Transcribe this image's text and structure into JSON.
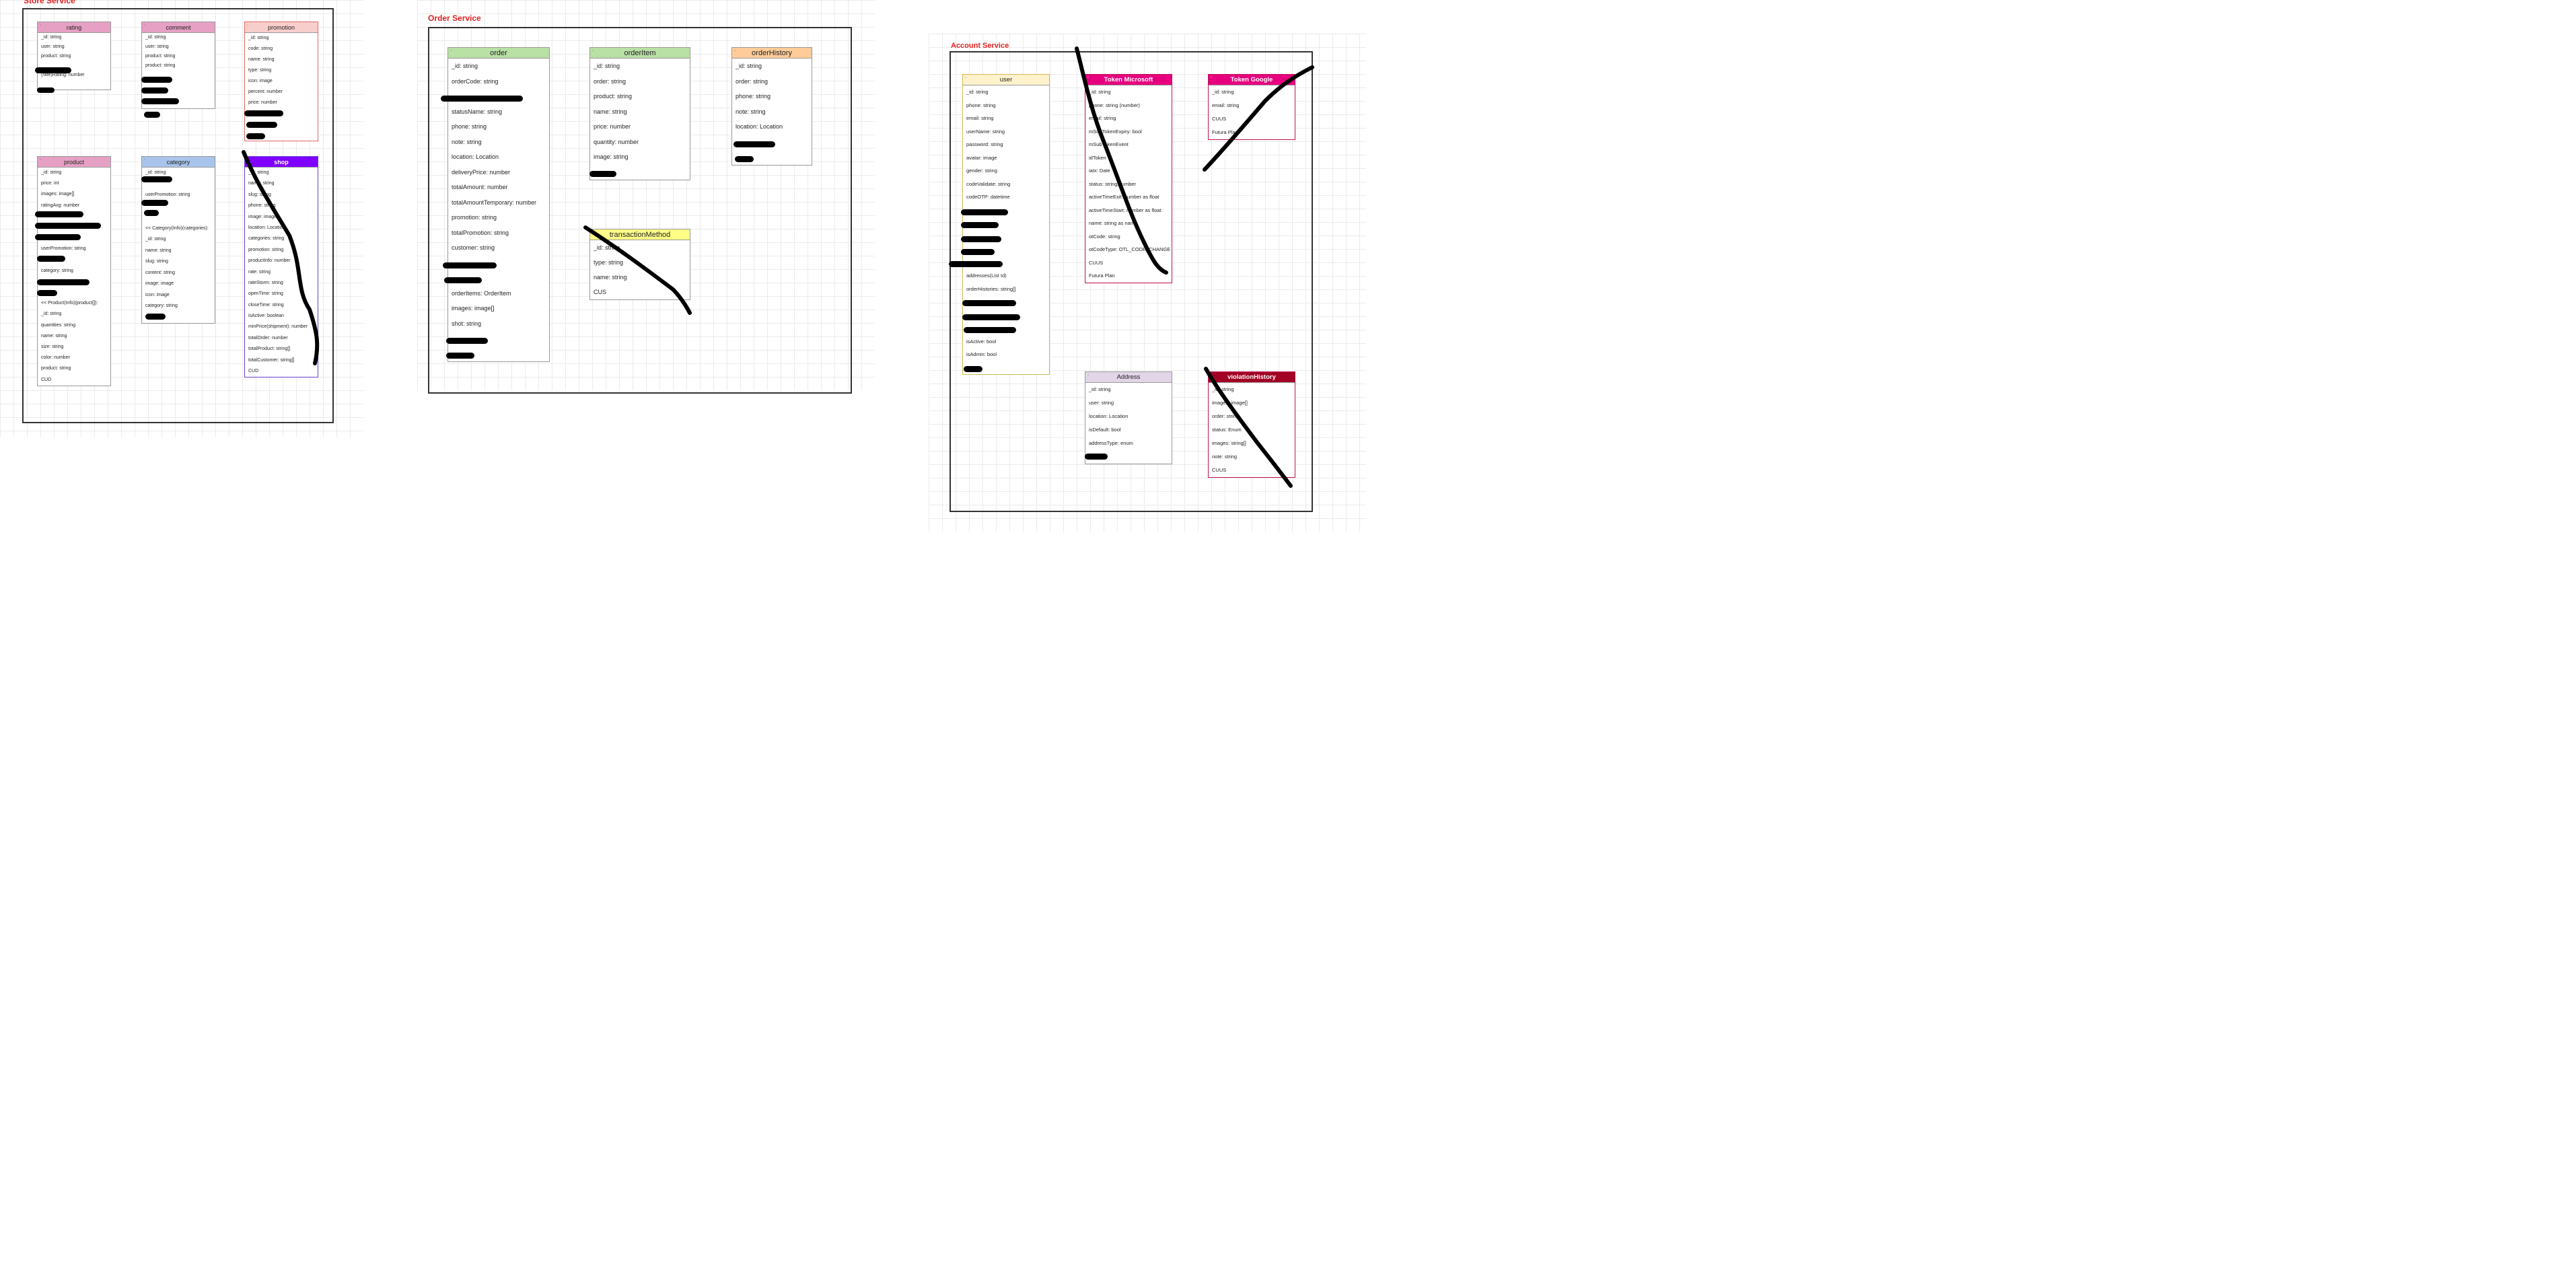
{
  "services": {
    "store": {
      "title": "Store Service"
    },
    "order": {
      "title": "Order Service"
    },
    "account": {
      "title": "Account Service"
    }
  },
  "entities": {
    "rating": {
      "title": "rating",
      "rows": [
        {
          "text": "_id: string"
        },
        {
          "text": "user: string",
          "c": "blue"
        },
        {
          "text": "product: string",
          "c": "blue"
        },
        {
          "text": ""
        },
        {
          "text": "(rate)Rating: number"
        },
        {
          "text": ""
        }
      ]
    },
    "comment": {
      "title": "comment",
      "rows": [
        {
          "text": "_id: string"
        },
        {
          "text": "user: string",
          "c": "blue"
        },
        {
          "text": "product: string",
          "c": "blue"
        },
        {
          "text": "product: string",
          "c": "blue"
        },
        {
          "text": ""
        },
        {
          "text": ""
        },
        {
          "text": ""
        },
        {
          "text": ""
        }
      ]
    },
    "promotion": {
      "title": "promotion",
      "rows": [
        {
          "text": "_id: string"
        },
        {
          "text": "code: string"
        },
        {
          "text": "name: string"
        },
        {
          "text": "type: string"
        },
        {
          "text": "icon: image"
        },
        {
          "text": "percent: number"
        },
        {
          "text": "price: number"
        },
        {
          "text": ""
        },
        {
          "text": ""
        },
        {
          "text": ""
        }
      ]
    },
    "product": {
      "title": "product",
      "rows": [
        {
          "text": "_id: string"
        },
        {
          "text": "price: int"
        },
        {
          "text": "images: image[]"
        },
        {
          "text": "ratingAvg: number"
        },
        {
          "text": ""
        },
        {
          "text": ""
        },
        {
          "text": ""
        },
        {
          "text": "userPromotion: string",
          "c": "blue"
        },
        {
          "text": ""
        },
        {
          "text": "category: string",
          "c": "blue"
        },
        {
          "text": ""
        },
        {
          "text": ""
        },
        {
          "text": "<< Product(Info)(product[]):",
          "c": "blue"
        },
        {
          "text": "   _id: string"
        },
        {
          "text": "   quantities: string"
        },
        {
          "text": "   name: string"
        },
        {
          "text": "   size: string"
        },
        {
          "text": "   color: number"
        },
        {
          "text": "   product: string",
          "c": "blue"
        },
        {
          "text": "   CUD"
        }
      ]
    },
    "category": {
      "title": "category",
      "rows": [
        {
          "text": "_id: string"
        },
        {
          "text": ""
        },
        {
          "text": "userPromotion: string",
          "c": "blue"
        },
        {
          "text": ""
        },
        {
          "text": ""
        },
        {
          "text": "<< Category(Info)(categories):",
          "c": "blue"
        },
        {
          "text": "   _id: string"
        },
        {
          "text": "   name: string"
        },
        {
          "text": "   slug: string"
        },
        {
          "text": "   content: string"
        },
        {
          "text": "   image: image"
        },
        {
          "text": "   icon: image"
        },
        {
          "text": "   category: string",
          "c": "blue"
        },
        {
          "text": ""
        }
      ]
    },
    "shop": {
      "title": "shop",
      "rows": [
        {
          "text": "_id: string"
        },
        {
          "text": "name: string"
        },
        {
          "text": "slug: string"
        },
        {
          "text": "phone: string"
        },
        {
          "text": "image: image"
        },
        {
          "text": "location: Location"
        },
        {
          "text": "categories: string",
          "c": "blue"
        },
        {
          "text": "promotion: string",
          "c": "blue"
        },
        {
          "text": "productInfo: number"
        },
        {
          "text": "rate: string"
        },
        {
          "text": "rateStorm: string"
        },
        {
          "text": "openTime: string"
        },
        {
          "text": "closeTime: string"
        },
        {
          "text": "isActive: boolean"
        },
        {
          "text": "minPrice(shipment): number"
        },
        {
          "text": "totalOrder: number"
        },
        {
          "text": "totalProduct: string[]"
        },
        {
          "text": "totalCustomer: string[]"
        },
        {
          "text": "CUD",
          "c": "blue"
        }
      ]
    },
    "order": {
      "title": "order",
      "rows": [
        {
          "text": "_id: string"
        },
        {
          "text": "orderCode: string"
        },
        {
          "text": ""
        },
        {
          "text": "statusName: string"
        },
        {
          "text": "phone: string"
        },
        {
          "text": "note: string"
        },
        {
          "text": "location: Location"
        },
        {
          "text": "deliveryPrice: number"
        },
        {
          "text": "totalAmount: number"
        },
        {
          "text": "totalAmountTemporary: number"
        },
        {
          "text": "promotion: string",
          "c": "blue"
        },
        {
          "text": "totalPromotion: string"
        },
        {
          "text": "customer: string",
          "c": "blue"
        },
        {
          "text": ""
        },
        {
          "text": ""
        },
        {
          "text": "orderItems: OrderItem",
          "c": "blue"
        },
        {
          "text": "images: image[]"
        },
        {
          "text": "shot: string",
          "c": "blue"
        },
        {
          "text": ""
        },
        {
          "text": ""
        }
      ]
    },
    "orderItem": {
      "title": "orderItem",
      "rows": [
        {
          "text": "_id: string"
        },
        {
          "text": "order: string",
          "c": "blue"
        },
        {
          "text": "product: string",
          "c": "blue"
        },
        {
          "text": "name: string"
        },
        {
          "text": "price: number"
        },
        {
          "text": "quantity: number"
        },
        {
          "text": "image: string"
        },
        {
          "text": ""
        }
      ]
    },
    "orderHistory": {
      "title": "orderHistory",
      "rows": [
        {
          "text": "_id: string"
        },
        {
          "text": "order: string",
          "c": "blue"
        },
        {
          "text": "phone: string"
        },
        {
          "text": "note: string"
        },
        {
          "text": "location: Location"
        },
        {
          "text": ""
        },
        {
          "text": ""
        }
      ]
    },
    "transactionMethod": {
      "title": "transactionMethod",
      "rows": [
        {
          "text": "_id: string"
        },
        {
          "text": "type: string"
        },
        {
          "text": "name: string"
        },
        {
          "text": "CUS"
        }
      ]
    },
    "user": {
      "title": "user",
      "rows": [
        {
          "text": "_id: string"
        },
        {
          "text": "phone: string",
          "c": "blue"
        },
        {
          "text": "email: string"
        },
        {
          "text": "userName: string"
        },
        {
          "text": "password: string"
        },
        {
          "text": "avatar: image"
        },
        {
          "text": "gender: string"
        },
        {
          "text": "codeValidate: string"
        },
        {
          "text": "codeOTP: datetime"
        },
        {
          "text": ""
        },
        {
          "text": ""
        },
        {
          "text": ""
        },
        {
          "text": ""
        },
        {
          "text": ""
        },
        {
          "text": "addresses(List Id)",
          "c": "blue"
        },
        {
          "text": "orderHistories: string[]",
          "c": "blue"
        },
        {
          "text": ""
        },
        {
          "text": ""
        },
        {
          "text": ""
        },
        {
          "text": "isActive: bool"
        },
        {
          "text": "isAdmin: bool"
        },
        {
          "text": ""
        }
      ]
    },
    "tokenMicrosoft": {
      "title": "Token Microsoft",
      "rows": [
        {
          "text": "_id: string"
        },
        {
          "text": "phone: string (number)",
          "c": "blue"
        },
        {
          "text": "email: string"
        },
        {
          "text": "mSubTokenExpiry: bool"
        },
        {
          "text": "mSubTokenEvent"
        },
        {
          "text": "idToken"
        },
        {
          "text": "iatx: Date"
        },
        {
          "text": "status: string,number"
        },
        {
          "text": "activeTimeExit: number as float"
        },
        {
          "text": "activeTimeStart: number as float"
        },
        {
          "text": "name: string as name"
        },
        {
          "text": "otCode: string"
        },
        {
          "text": "otCodeType: OTL_CODE_CHANGE"
        },
        {
          "text": "CUUS"
        },
        {
          "text": "Futura Plan",
          "c": "red"
        }
      ]
    },
    "tokenGoogle": {
      "title": "Token Google",
      "rows": [
        {
          "text": "_id: string"
        },
        {
          "text": "email: string"
        },
        {
          "text": "CUUS"
        },
        {
          "text": "Futura Plan",
          "c": "red"
        }
      ]
    },
    "address": {
      "title": "Address",
      "rows": [
        {
          "text": "_id: string"
        },
        {
          "text": "user: string",
          "c": "blue"
        },
        {
          "text": "location: Location"
        },
        {
          "text": "isDefault: bool"
        },
        {
          "text": "addressType: enum"
        },
        {
          "text": ""
        }
      ]
    },
    "violationHistory": {
      "title": "violationHistory",
      "rows": [
        {
          "text": "_id: string"
        },
        {
          "text": "images: image[]"
        },
        {
          "text": "order: string",
          "c": "blue"
        },
        {
          "text": "status: Enum",
          "c": "blue"
        },
        {
          "text": "images: string[]"
        },
        {
          "text": "note: string"
        },
        {
          "text": "CUUS"
        }
      ]
    }
  },
  "colors": {
    "service_title": "#e02020",
    "rating": "#e6a0c4",
    "comment": "#e6a0c4",
    "promotion": "#f8cecc",
    "product": "#e6a0c4",
    "category": "#a9c4eb",
    "shop": "#7f00ff",
    "order": "#b9e0a5",
    "orderItem": "#b9e0a5",
    "orderHistory": "#ffcc99",
    "transactionMethod": "#ffff88",
    "user": "#fff2cc",
    "tokenMicrosoft": "#e6007e",
    "tokenGoogle": "#e6007e",
    "address": "#e1d5e7",
    "violationHistory": "#a20025"
  }
}
